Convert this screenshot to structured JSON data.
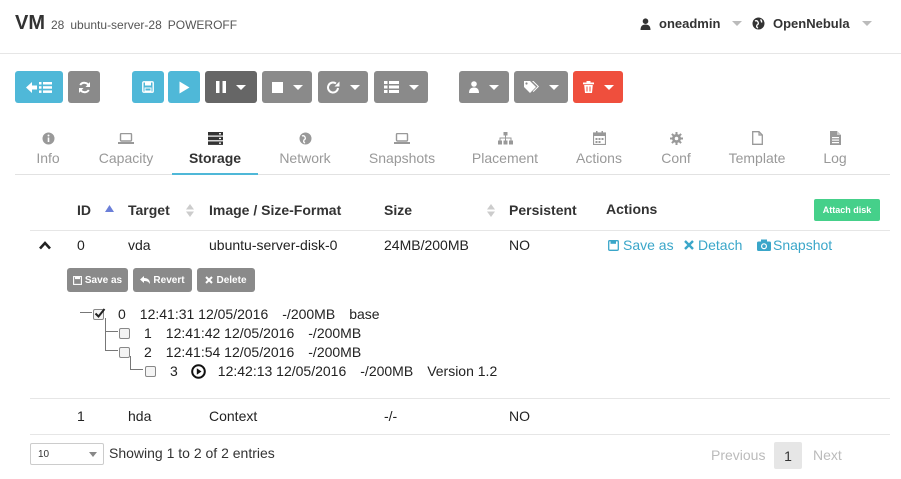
{
  "header": {
    "vm_label": "VM",
    "vm_id": "28",
    "vm_name": "ubuntu-server-28",
    "vm_state": "POWEROFF",
    "user": "oneadmin",
    "zone": "OpenNebula"
  },
  "toolbar": {
    "icons": [
      "back-list-icon",
      "refresh-icon",
      "save-icon",
      "play-icon",
      "pause-icon",
      "stop-icon",
      "reboot-icon",
      "list-icon",
      "user-icon",
      "tags-icon",
      "trash-icon"
    ],
    "colors": {
      "primary": "#4fb8d8",
      "secondary": "#8a8a8a",
      "dark": "#666666",
      "danger": "#ef4f3d"
    }
  },
  "tabs": [
    {
      "label": "Info",
      "icon": "info-icon"
    },
    {
      "label": "Capacity",
      "icon": "laptop-icon"
    },
    {
      "label": "Storage",
      "icon": "storage-icon",
      "active": true
    },
    {
      "label": "Network",
      "icon": "globe-icon"
    },
    {
      "label": "Snapshots",
      "icon": "laptop-icon"
    },
    {
      "label": "Placement",
      "icon": "sitemap-icon"
    },
    {
      "label": "Actions",
      "icon": "calendar-icon"
    },
    {
      "label": "Conf",
      "icon": "gear-icon"
    },
    {
      "label": "Template",
      "icon": "file-icon"
    },
    {
      "label": "Log",
      "icon": "file-text-icon"
    }
  ],
  "table": {
    "columns": [
      "ID",
      "Target",
      "Image / Size-Format",
      "Size",
      "Persistent",
      "Actions"
    ],
    "attach_label": "Attach disk",
    "rows": [
      {
        "id": "0",
        "target": "vda",
        "image": "ubuntu-server-disk-0",
        "size": "24MB/200MB",
        "persistent": "NO",
        "actions": [
          "Save as",
          "Detach",
          "Snapshot"
        ]
      },
      {
        "id": "1",
        "target": "hda",
        "image": "Context",
        "size": "-/-",
        "persistent": "NO"
      }
    ],
    "snapshot_buttons": [
      "Save as",
      "Revert",
      "Delete"
    ],
    "snapshots": [
      {
        "id": "0",
        "date": "12:41:31 12/05/2016",
        "size": "-/200MB",
        "name": "base",
        "checked": true
      },
      {
        "id": "1",
        "date": "12:41:42 12/05/2016",
        "size": "-/200MB",
        "name": ""
      },
      {
        "id": "2",
        "date": "12:41:54 12/05/2016",
        "size": "-/200MB",
        "name": ""
      },
      {
        "id": "3",
        "date": "12:42:13 12/05/2016",
        "size": "-/200MB",
        "name": "Version 1.2",
        "active": true
      }
    ]
  },
  "footer": {
    "page_size": "10",
    "showing": "Showing 1 to 2 of 2 entries",
    "previous": "Previous",
    "page": "1",
    "next": "Next"
  }
}
